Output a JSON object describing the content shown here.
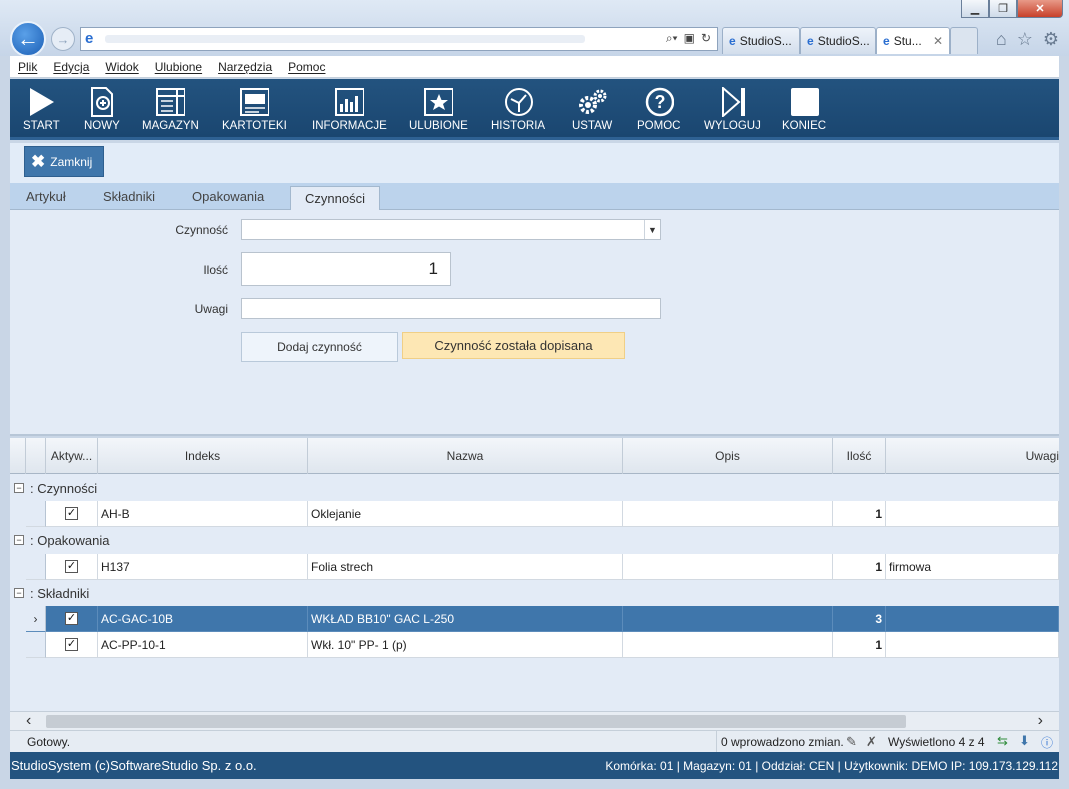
{
  "browser": {
    "tabs": [
      {
        "label": "StudioS..."
      },
      {
        "label": "StudioS..."
      },
      {
        "label": "Stu..."
      }
    ],
    "close_tab_glyph": "✕"
  },
  "menu": [
    "Plik",
    "Edycja",
    "Widok",
    "Ulubione",
    "Narzędzia",
    "Pomoc"
  ],
  "toolbar": [
    {
      "label": "START",
      "icon": "play-icon"
    },
    {
      "label": "NOWY",
      "icon": "new-document-icon"
    },
    {
      "label": "MAGAZYN",
      "icon": "warehouse-icon"
    },
    {
      "label": "KARTOTEKI",
      "icon": "cards-icon"
    },
    {
      "label": "INFORMACJE",
      "icon": "chart-icon"
    },
    {
      "label": "ULUBIONE",
      "icon": "star-icon"
    },
    {
      "label": "HISTORIA",
      "icon": "history-icon"
    },
    {
      "label": "USTAW",
      "icon": "gears-icon"
    },
    {
      "label": "POMOC",
      "icon": "help-icon"
    },
    {
      "label": "WYLOGUJ",
      "icon": "logout-icon"
    },
    {
      "label": "KONIEC",
      "icon": "stop-icon"
    }
  ],
  "close_button": {
    "label": "Zamknij"
  },
  "form_tabs": [
    "Artykuł",
    "Składniki",
    "Opakowania",
    "Czynności"
  ],
  "form": {
    "czynnosc_label": "Czynność",
    "czynnosc_value": "",
    "ilosc_label": "Ilość",
    "ilosc_value": "1",
    "uwagi_label": "Uwagi",
    "uwagi_value": "",
    "add_button": "Dodaj czynność",
    "message": "Czynność została dopisana"
  },
  "grid": {
    "columns": [
      "Aktyw...",
      "Indeks",
      "Nazwa",
      "Opis",
      "Ilość",
      "Uwagi"
    ],
    "groups": [
      {
        "title": ": Czynności",
        "rows": [
          {
            "checked": true,
            "index": "AH-B",
            "name": "Oklejanie",
            "desc": "",
            "qty": "1",
            "notes": ""
          }
        ]
      },
      {
        "title": ": Opakowania",
        "rows": [
          {
            "checked": true,
            "index": "H137",
            "name": "Folia strech",
            "desc": "",
            "qty": "1",
            "notes": "firmowa"
          }
        ]
      },
      {
        "title": ": Składniki",
        "rows": [
          {
            "checked": true,
            "index": "AC-GAC-10B",
            "name": "WKŁAD BB10\" GAC L-250",
            "desc": "",
            "qty": "3",
            "notes": "",
            "selected": true
          },
          {
            "checked": true,
            "index": "AC-PP-10-1",
            "name": "Wkł. 10\" PP- 1 (p)",
            "desc": "",
            "qty": "1",
            "notes": ""
          }
        ]
      }
    ]
  },
  "status": {
    "left": "Gotowy.",
    "changes": "0 wprowadzono zmian.",
    "shown": "Wyświetlono 4 z 4"
  },
  "footer": {
    "left": "StudioSystem (c)SoftwareStudio Sp. z o.o.",
    "right": "Komórka: 01 | Magazyn: 01 | Oddział: CEN | Użytkownik: DEMO IP: 109.173.129.112"
  }
}
